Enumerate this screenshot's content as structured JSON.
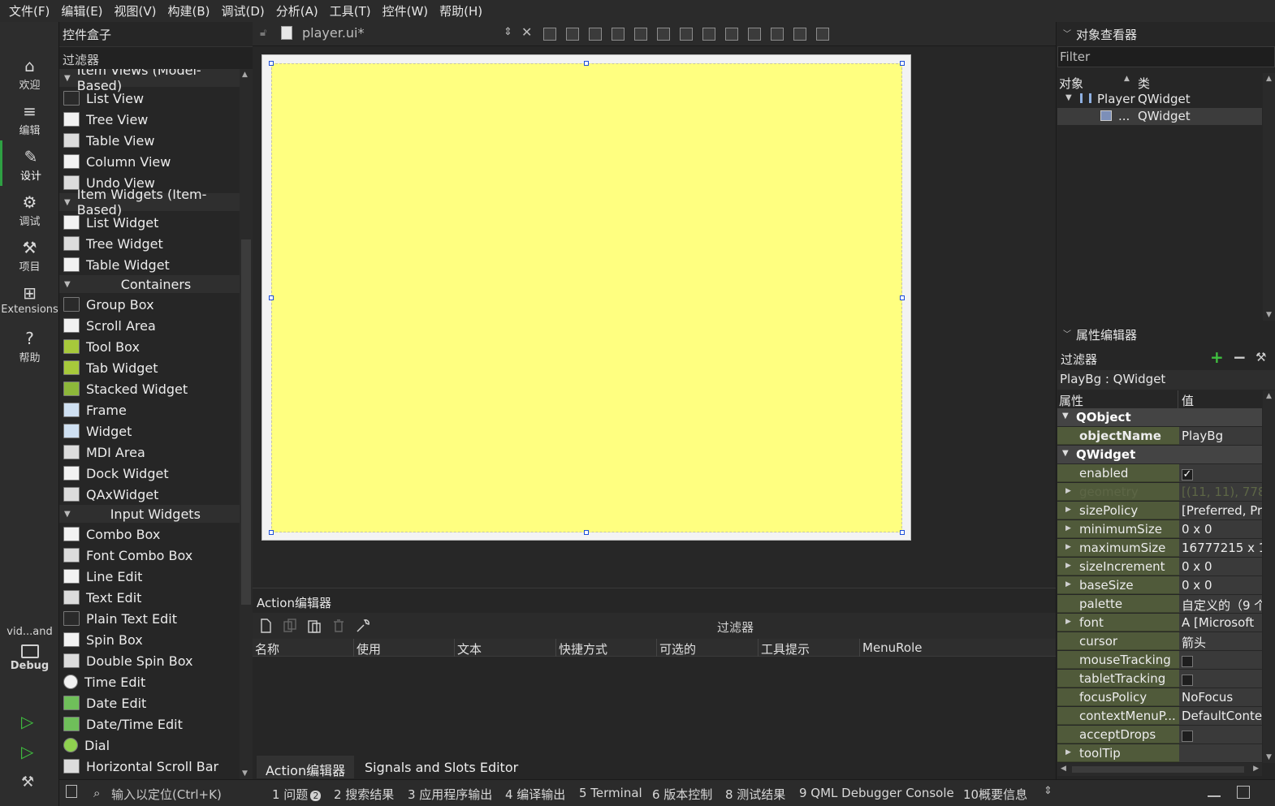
{
  "menubar": {
    "items": [
      "文件(F)",
      "编辑(E)",
      "视图(V)",
      "构建(B)",
      "调试(D)",
      "分析(A)",
      "工具(T)",
      "控件(W)",
      "帮助(H)"
    ]
  },
  "modebar": {
    "modes": [
      {
        "label": "欢迎",
        "icon": "home-icon"
      },
      {
        "label": "编辑",
        "icon": "edit-lines-icon"
      },
      {
        "label": "设计",
        "icon": "pen-icon"
      },
      {
        "label": "调试",
        "icon": "bug-icon"
      },
      {
        "label": "项目",
        "icon": "wrench-icon"
      },
      {
        "label": "Extensions",
        "icon": "extensions-icon"
      },
      {
        "label": "帮助",
        "icon": "help-icon"
      }
    ],
    "kit_label": "vid...and",
    "kit_mode": "Debug"
  },
  "widgetbox": {
    "title": "控件盒子",
    "filter_placeholder": "过滤器",
    "rows": [
      {
        "type": "cat",
        "label": "Item Views (Model-Based)"
      },
      {
        "type": "item",
        "label": "List View"
      },
      {
        "type": "item",
        "label": "Tree View"
      },
      {
        "type": "item",
        "label": "Table View"
      },
      {
        "type": "item",
        "label": "Column View"
      },
      {
        "type": "item",
        "label": "Undo View"
      },
      {
        "type": "cat",
        "label": "Item Widgets (Item-Based)"
      },
      {
        "type": "item",
        "label": "List Widget"
      },
      {
        "type": "item",
        "label": "Tree Widget"
      },
      {
        "type": "item",
        "label": "Table Widget"
      },
      {
        "type": "cat",
        "label": "Containers"
      },
      {
        "type": "item",
        "label": "Group Box"
      },
      {
        "type": "item",
        "label": "Scroll Area"
      },
      {
        "type": "item",
        "label": "Tool Box"
      },
      {
        "type": "item",
        "label": "Tab Widget"
      },
      {
        "type": "item",
        "label": "Stacked Widget"
      },
      {
        "type": "item",
        "label": "Frame"
      },
      {
        "type": "item",
        "label": "Widget"
      },
      {
        "type": "item",
        "label": "MDI Area"
      },
      {
        "type": "item",
        "label": "Dock Widget"
      },
      {
        "type": "item",
        "label": "QAxWidget"
      },
      {
        "type": "cat",
        "label": "Input Widgets"
      },
      {
        "type": "item",
        "label": "Combo Box"
      },
      {
        "type": "item",
        "label": "Font Combo Box"
      },
      {
        "type": "item",
        "label": "Line Edit"
      },
      {
        "type": "item",
        "label": "Text Edit"
      },
      {
        "type": "item",
        "label": "Plain Text Edit"
      },
      {
        "type": "item",
        "label": "Spin Box"
      },
      {
        "type": "item",
        "label": "Double Spin Box"
      },
      {
        "type": "item",
        "label": "Time Edit"
      },
      {
        "type": "item",
        "label": "Date Edit"
      },
      {
        "type": "item",
        "label": "Date/Time Edit"
      },
      {
        "type": "item",
        "label": "Dial"
      },
      {
        "type": "item",
        "label": "Horizontal Scroll Bar"
      }
    ]
  },
  "editor": {
    "file_name": "player.ui*"
  },
  "action_editor": {
    "title": "Action编辑器",
    "filter_label": "过滤器",
    "columns": [
      "名称",
      "使用",
      "文本",
      "快捷方式",
      "可选的",
      "工具提示",
      "MenuRole"
    ],
    "tabs": [
      "Action编辑器",
      "Signals and Slots Editor"
    ]
  },
  "object_inspector": {
    "title": "对象查看器",
    "filter_placeholder": "Filter",
    "col_object": "对象",
    "col_class": "类",
    "rows": [
      {
        "name": "Player",
        "class": "QWidget"
      },
      {
        "name": "...",
        "class": "QWidget"
      }
    ]
  },
  "property_editor": {
    "title": "属性编辑器",
    "filter_label": "过滤器",
    "class_label": "PlayBg : QWidget",
    "col_property": "属性",
    "col_value": "值",
    "rows": [
      {
        "type": "sect",
        "name": "QObject"
      },
      {
        "type": "prop",
        "name": "objectName",
        "value": "PlayBg",
        "bold": true
      },
      {
        "type": "sect",
        "name": "QWidget"
      },
      {
        "type": "prop",
        "name": "enabled",
        "value": "✓",
        "check": true
      },
      {
        "type": "prop",
        "name": "geometry",
        "value": "[(11, 11), 778",
        "expand": true,
        "dim": true
      },
      {
        "type": "prop",
        "name": "sizePolicy",
        "value": "[Preferred, Pr",
        "expand": true
      },
      {
        "type": "prop",
        "name": "minimumSize",
        "value": "0 x 0",
        "expand": true
      },
      {
        "type": "prop",
        "name": "maximumSize",
        "value": "16777215 x 1",
        "expand": true
      },
      {
        "type": "prop",
        "name": "sizeIncrement",
        "value": "0 x 0",
        "expand": true
      },
      {
        "type": "prop",
        "name": "baseSize",
        "value": "0 x 0",
        "expand": true
      },
      {
        "type": "prop",
        "name": "palette",
        "value": "自定义的（9 个"
      },
      {
        "type": "prop",
        "name": "font",
        "value": "A [Microsoft",
        "expand": true
      },
      {
        "type": "prop",
        "name": "cursor",
        "value": "箭头"
      },
      {
        "type": "prop",
        "name": "mouseTracking",
        "value": "",
        "check": false
      },
      {
        "type": "prop",
        "name": "tabletTracking",
        "value": "",
        "check": false
      },
      {
        "type": "prop",
        "name": "focusPolicy",
        "value": "NoFocus"
      },
      {
        "type": "prop",
        "name": "contextMenuP...",
        "value": "DefaultConte"
      },
      {
        "type": "prop",
        "name": "acceptDrops",
        "value": "",
        "check": false
      },
      {
        "type": "prop",
        "name": "toolTip",
        "value": "",
        "expand": true
      }
    ]
  },
  "statusbar": {
    "locate_placeholder": "输入以定位(Ctrl+K)",
    "items": [
      "1 问题",
      "2 搜索结果",
      "3 应用程序输出",
      "4 编译输出",
      "5 Terminal",
      "6 版本控制",
      "8 测试结果",
      "9 QML Debugger Console",
      "10概要信息"
    ],
    "issues_count": "2"
  },
  "colors": {
    "form_background": "#ffff80",
    "selection_handle": "#1d4fd8",
    "modified_property": "#505a3a"
  }
}
